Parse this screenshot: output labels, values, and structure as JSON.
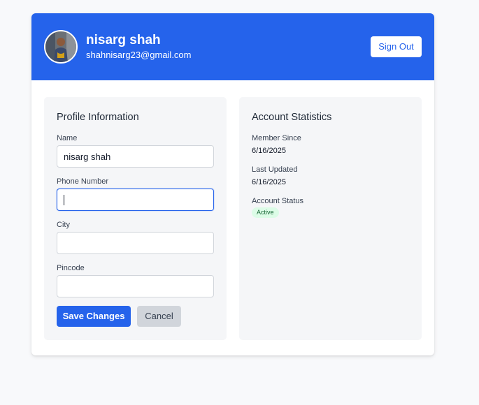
{
  "header": {
    "user_name": "nisarg shah",
    "user_email": "shahnisarg23@gmail.com",
    "sign_out_label": "Sign Out"
  },
  "profile": {
    "title": "Profile Information",
    "fields": [
      {
        "label": "Name",
        "value": "nisarg shah",
        "focused": false
      },
      {
        "label": "Phone Number",
        "value": "",
        "focused": true
      },
      {
        "label": "City",
        "value": "",
        "focused": false
      },
      {
        "label": "Pincode",
        "value": "",
        "focused": false
      }
    ],
    "save_label": "Save Changes",
    "cancel_label": "Cancel"
  },
  "stats": {
    "title": "Account Statistics",
    "member_since_label": "Member Since",
    "member_since_value": "6/16/2025",
    "last_updated_label": "Last Updated",
    "last_updated_value": "6/16/2025",
    "status_label": "Account Status",
    "status_value": "Active"
  },
  "colors": {
    "primary": "#2563eb",
    "background": "#f8f9fb",
    "panel": "#f5f6f8",
    "badge_bg": "#dcfce7",
    "badge_text": "#166534"
  }
}
